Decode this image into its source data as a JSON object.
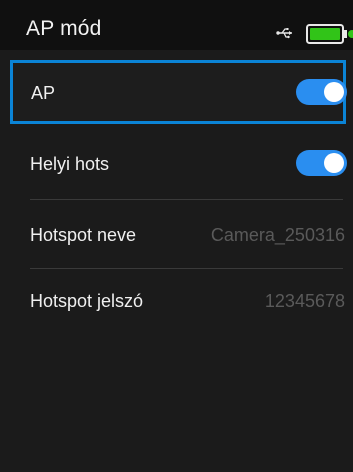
{
  "status_bar": {
    "title": "AP mód",
    "usb_icon": "usb-icon",
    "battery_icon": "battery-icon",
    "battery_color": "#31c418"
  },
  "settings": {
    "ap": {
      "label": "AP",
      "enabled": true
    },
    "local_hotspot": {
      "label": "Helyi hots",
      "enabled": true
    },
    "hotspot_name": {
      "label": "Hotspot neve",
      "value": "Camera_250316"
    },
    "hotspot_password": {
      "label": "Hotspot jelszó",
      "value": "12345678"
    }
  },
  "colors": {
    "selection_border": "#0b84d6",
    "toggle_on": "#2a8ef0"
  }
}
